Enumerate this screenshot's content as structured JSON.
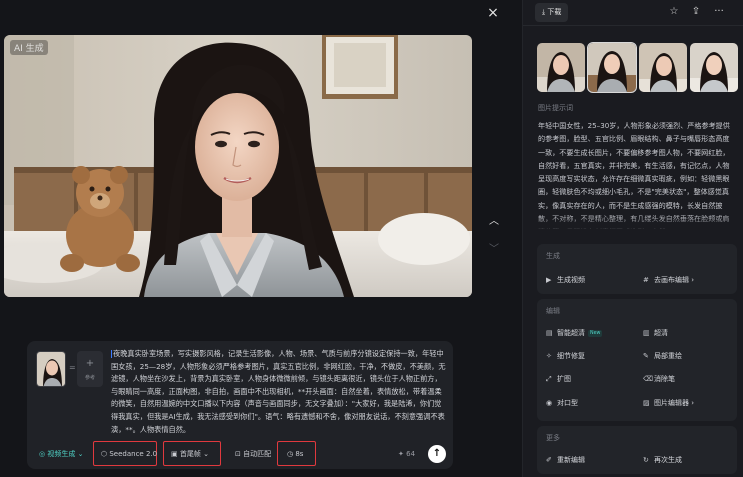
{
  "viewer": {
    "ai_badge": "AI 生成",
    "close_icon": "×",
    "nav_up_icon": "︿",
    "nav_down_icon": "﹀"
  },
  "prompt": {
    "add_ref_plus": "+",
    "add_ref_label": "参考",
    "eq_sign": "=",
    "text": "夜晚真实卧室场景，写实摄影风格，记录生活影像，人物、场景、气质与前序分镜设定保持一致，年轻中国女孩，25—28岁，人物形象必须严格参考图片，真实五官比例，非网红脸，干净，不做皮，不美颜，无滤镜，人物坐在沙发上，背景为真实卧室，人物身体微微前倾，与镜头距离很近，镜头位于人物正前方，与眼睛同一高度，正面构图，非自拍，画面中不出现相机，**开头画面：自然坐着，表情放松，带着温柔的微笑，自然用温婉的中文口播以下内容（声音与画面同步，无文字叠加）：\"大家好，我是陆浠，你们觉得我真实，但我是AI生成，我无法感受到你们\"。语气：略有遗憾和不舍，像对朋友说话，不刻意强调不表演，**。人物表情自然。"
  },
  "toolbar": {
    "mode_label": "视频生成",
    "model_label": "Seedance 2.0",
    "ratio_label": "首尾帧",
    "auto_label": "自动匹配",
    "duration_label": "8s",
    "credit_count": "64",
    "send_icon": "↑",
    "chevron": "⌄"
  },
  "sidebar": {
    "download_label": "下载",
    "star_icon": "☆",
    "share_icon": "⇪",
    "more_icon": "···",
    "prompt_section_title": "图片提示词",
    "prompt_description": "年轻中国女性，25–30岁，人物形象必须强烈、严格参考提供的参考图，脸型、五官比例、眉眼结构、鼻子与嘴唇形态高度一致，不要生成长图片，不要偏移参考图人物，不要网红脸，自然好看，五官真实，并非完美，有生活感，有记忆点，人物呈现高度写实状态，允许存在细微真实瑕疵，例如：轻微黑眼圈，轻微肤色不均或细小毛孔，不是\"完美状态\"，整体感觉真实，像真实存在的人，而不是生成感强的模特，长发自然披散，不对称，不是精心整理，有几缕头发自然垂落在脸颊或肩膀位置，呈现没有刻意摆弄或造型，自然",
    "generate": {
      "title": "生成",
      "items": [
        "生成视频",
        "去画布编辑"
      ]
    },
    "edit": {
      "title": "编辑",
      "items": [
        "智能超清",
        "超清",
        "细节修复",
        "局部重绘",
        "扩图",
        "消除笔",
        "对口型",
        "图片编辑器"
      ],
      "new_tag": "New"
    },
    "more": {
      "title": "更多",
      "items": [
        "重新编辑",
        "再次生成"
      ]
    }
  }
}
